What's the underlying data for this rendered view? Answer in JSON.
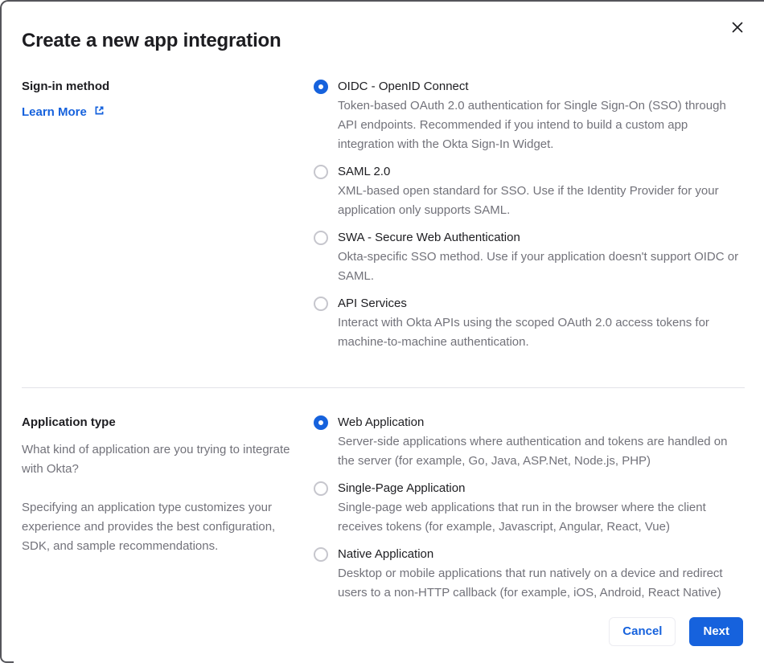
{
  "dialog": {
    "title": "Create a new app integration",
    "icons": {
      "close": "close-x",
      "external_link": "box-with-arrow"
    }
  },
  "signin_section": {
    "heading": "Sign-in method",
    "learn_more_label": "Learn More",
    "options": [
      {
        "label": "OIDC - OpenID Connect",
        "description": "Token-based OAuth 2.0 authentication for Single Sign-On (SSO) through API endpoints. Recommended if you intend to build a custom app integration with the Okta Sign-In Widget.",
        "selected": true
      },
      {
        "label": "SAML 2.0",
        "description": "XML-based open standard for SSO. Use if the Identity Provider for your application only supports SAML.",
        "selected": false
      },
      {
        "label": "SWA - Secure Web Authentication",
        "description": "Okta-specific SSO method. Use if your application doesn't support OIDC or SAML.",
        "selected": false
      },
      {
        "label": "API Services",
        "description": "Interact with Okta APIs using the scoped OAuth 2.0 access tokens for machine-to-machine authentication.",
        "selected": false
      }
    ]
  },
  "apptype_section": {
    "heading": "Application type",
    "paragraph1": "What kind of application are you trying to integrate with Okta?",
    "paragraph2": "Specifying an application type customizes your experience and provides the best configuration, SDK, and sample recommendations.",
    "options": [
      {
        "label": "Web Application",
        "description": "Server-side applications where authentication and tokens are handled on the server (for example, Go, Java, ASP.Net, Node.js, PHP)",
        "selected": true
      },
      {
        "label": "Single-Page Application",
        "description": "Single-page web applications that run in the browser where the client receives tokens (for example, Javascript, Angular, React, Vue)",
        "selected": false
      },
      {
        "label": "Native Application",
        "description": "Desktop or mobile applications that run natively on a device and redirect users to a non-HTTP callback (for example, iOS, Android, React Native)",
        "selected": false
      }
    ]
  },
  "footer": {
    "cancel_label": "Cancel",
    "next_label": "Next"
  },
  "colors": {
    "primary_blue": "#1662dd",
    "text_dark": "#1d1d21",
    "text_gray": "#72727a",
    "divider": "#e3e3e8",
    "frame_border": "#55555a"
  }
}
